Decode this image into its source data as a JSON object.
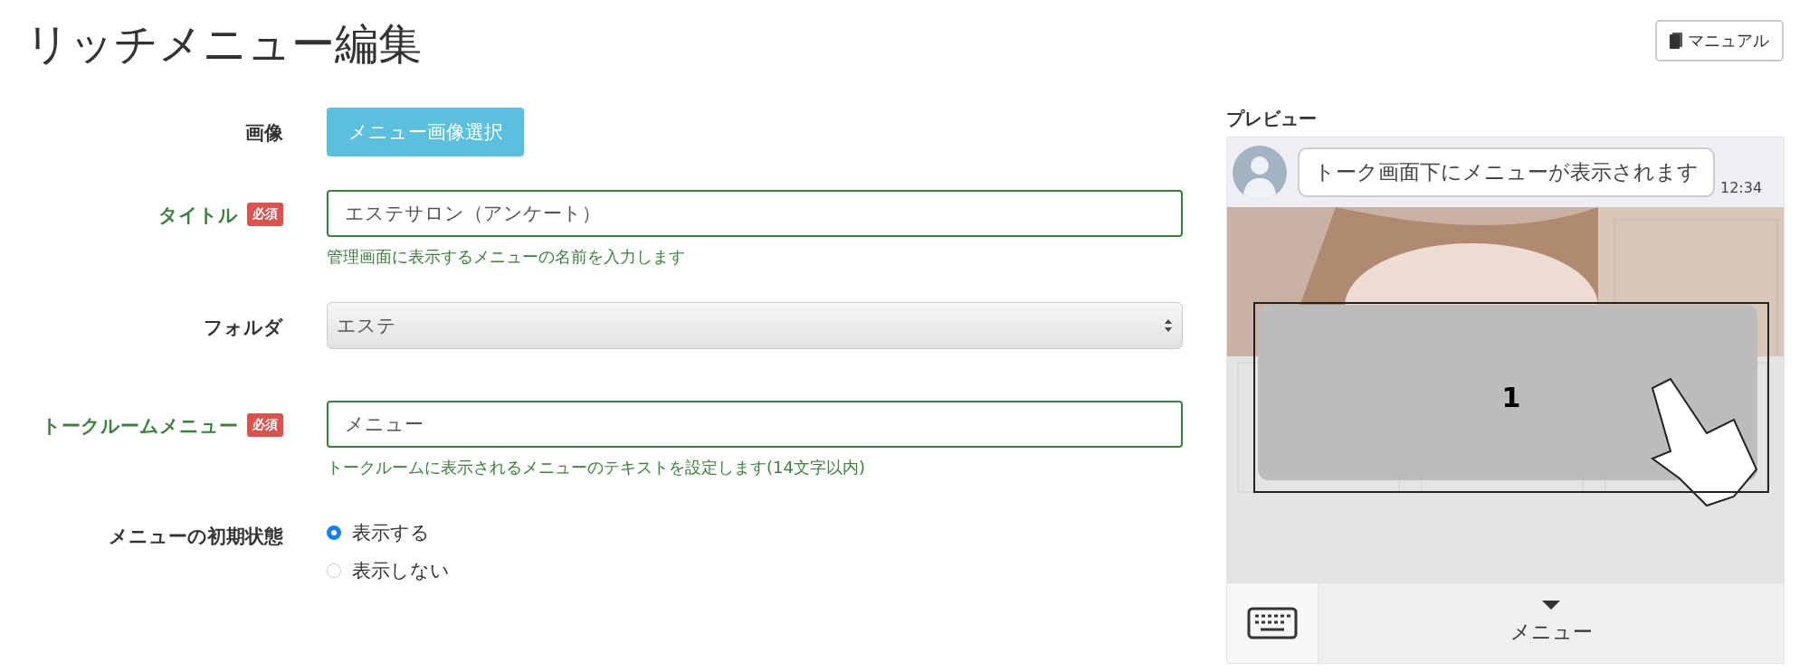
{
  "page": {
    "title": "リッチメニュー編集"
  },
  "manual_button": {
    "label": "マニュアル"
  },
  "form": [
    {
      "kind": "button",
      "label": "画像",
      "required": false,
      "button": "メニュー画像選択"
    },
    {
      "kind": "text",
      "label": "タイトル",
      "required": true,
      "required_badge": "必須",
      "value": "エステサロン（アンケート）",
      "hint": "管理画面に表示するメニューの名前を入力します"
    },
    {
      "kind": "select",
      "label": "フォルダ",
      "required": false,
      "value": "エステ"
    },
    {
      "kind": "text",
      "label": "トークルームメニュー",
      "required": true,
      "required_badge": "必須",
      "value": "メニュー",
      "hint": "トークルームに表示されるメニューのテキストを設定します(14文字以内)"
    },
    {
      "kind": "radio",
      "label": "メニューの初期状態",
      "required": false,
      "options": [
        {
          "label": "表示する",
          "selected": true
        },
        {
          "label": "表示しない",
          "selected": false
        }
      ]
    }
  ],
  "preview": {
    "title": "プレビュー",
    "message": "トーク画面下にメニューが表示されます",
    "time": "12:34",
    "areas": [
      {
        "label": "1"
      }
    ],
    "menu_bar_label": "メニュー"
  }
}
